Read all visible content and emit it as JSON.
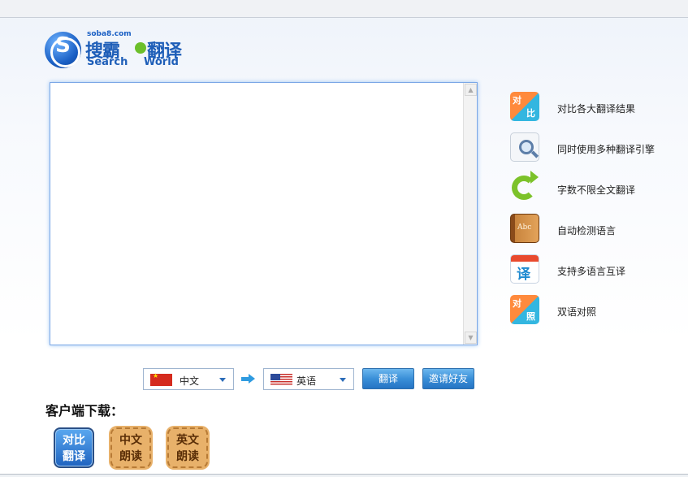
{
  "logo": {
    "site": "soba8.com",
    "cn_part1": "搜霸",
    "cn_part2": "翻译",
    "en_part1": "Search",
    "en_part2": "World",
    "mark": "S"
  },
  "editor": {
    "value": "",
    "placeholder": ""
  },
  "features": [
    {
      "icon": "compare-icon",
      "badge": "对比",
      "label": "对比各大翻译结果"
    },
    {
      "icon": "search-doc-icon",
      "label": "同时使用多种翻译引擎"
    },
    {
      "icon": "refresh-icon",
      "label": "字数不限全文翻译"
    },
    {
      "icon": "book-icon",
      "badge": "Abc",
      "label": "自动检测语言"
    },
    {
      "icon": "calendar-translate-icon",
      "badge": "译",
      "label": "支持多语言互译"
    },
    {
      "icon": "contrast-icon",
      "badge": "对照",
      "label": "双语对照"
    }
  ],
  "translate_bar": {
    "source_lang": "中文",
    "target_lang": "英语",
    "translate_label": "翻译",
    "invite_label": "邀请好友"
  },
  "client_download": {
    "title": "客户端下载：",
    "items": [
      {
        "line1": "对比",
        "line2": "翻译",
        "style": "blue"
      },
      {
        "line1": "中文",
        "line2": "朗读",
        "style": "tan"
      },
      {
        "line1": "英文",
        "line2": "朗读",
        "style": "tan"
      }
    ]
  },
  "colors": {
    "accent_blue": "#1e5eb8",
    "button_blue": "#3a8fd8",
    "green": "#7cc22a",
    "tan": "#e8b16a"
  }
}
